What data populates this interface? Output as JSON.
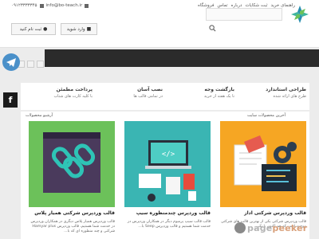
{
  "topbar": {
    "nav": [
      "راهنمای خرید",
      "ثبت شکایات",
      "درباره",
      "تماس",
      "فروشگاه"
    ],
    "phone": "۰۹۱۲۳۳۳۳۳۴۵",
    "email": "info@bo-teach.ir"
  },
  "header": {
    "search_placeholder": "",
    "login_label": "وارد شوید",
    "register_label": "ثبت نام کنید"
  },
  "features": [
    {
      "title": "طراحی استاندارد",
      "subtitle": "طرح های ارائه شده"
    },
    {
      "title": "بازگشت وجه",
      "subtitle": "تا یک هفته از خرید"
    },
    {
      "title": "نصب آسان",
      "subtitle": "در تمامی قالب ها"
    },
    {
      "title": "پرداخت مطمئن",
      "subtitle": "با کلیه کارت های شتاب"
    }
  ],
  "products": {
    "new_label": "آخرین محصولات سایت",
    "archive_label": "آرشیو محصولات",
    "items": [
      {
        "title": "قالب وردپرس شرکتی اداز",
        "desc": "قالب وردپرس شرکتی یکی از بهترین قالب های شرکتی موجود است که هم اکنون با یک..."
      },
      {
        "title": "قالب وردپرس چندمنظوره سیپ",
        "desc": "قالب قالب سیپ پرمیوم دیگر در همکاران وردپرس در خدمت شما هستیم و قالب وردپرس Seep با..."
      },
      {
        "title": "قالب وردپرس شرکتی همیار پلاس",
        "desc": "قالب وردپرس همیار پلاس دیگری در همکاران وردپرس در خدمت شما هستیم، قالب وردپرس Hamyar plus شرکتی و چند منظوره ای که با..."
      }
    ]
  },
  "social": {
    "facebook": "f"
  },
  "colors": {
    "accent": "#2a8fb0",
    "navband": "#2b2b2b",
    "telegram": "#4a90c9",
    "card_orange": "#f6a623",
    "card_teal": "#3ab5b3",
    "card_green": "#6cc15a"
  }
}
